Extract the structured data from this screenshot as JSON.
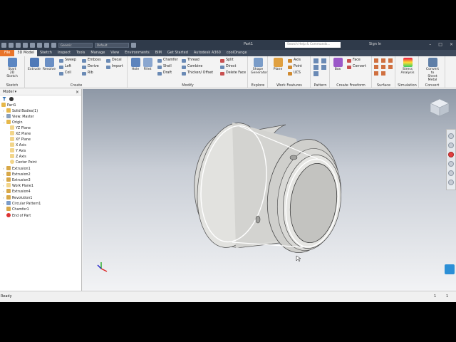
{
  "window": {
    "doc_title": "Part1",
    "search_placeholder": "Search Help & Commands...",
    "sign_in": "Sign In",
    "material": "Generic",
    "appearance": "Default"
  },
  "tabs": [
    "File",
    "3D Model",
    "Sketch",
    "Inspect",
    "Tools",
    "Manage",
    "View",
    "Environments",
    "BIM",
    "Get Started",
    "Autodesk A360",
    "coolOrange"
  ],
  "ribbon": {
    "sketch": {
      "start_line1": "Start",
      "start_line2": "2D Sketch",
      "group": "Sketch"
    },
    "create": {
      "extrude": "Extrude",
      "revolve": "Revolve",
      "sweep": "Sweep",
      "loft": "Loft",
      "coil": "Coil",
      "emboss": "Emboss",
      "derive": "Derive",
      "rib": "Rib",
      "decal": "Decal",
      "import": "Import",
      "group": "Create"
    },
    "modify": {
      "hole": "Hole",
      "fillet": "Fillet",
      "chamfer": "Chamfer",
      "shell": "Shell",
      "draft": "Draft",
      "thread": "Thread",
      "combine": "Combine",
      "thicken": "Thicken/ Offset",
      "split": "Split",
      "direct": "Direct",
      "delete_face": "Delete Face",
      "group": "Modify"
    },
    "explore": {
      "shape_line1": "Shape",
      "shape_line2": "Generator",
      "group": "Explore"
    },
    "work": {
      "plane": "Plane",
      "axis": "Axis",
      "point": "Point",
      "ucs": "UCS",
      "group": "Work Features"
    },
    "pattern": {
      "group": "Pattern"
    },
    "freeform": {
      "box": "Box",
      "face": "Face",
      "convert": "Convert",
      "group": "Create Freeform"
    },
    "surface": {
      "group": "Surface"
    },
    "simulation": {
      "stress_line1": "Stress",
      "stress_line2": "Analysis",
      "group": "Simulation"
    },
    "convert": {
      "sheet_line1": "Convert to",
      "sheet_line2": "Sheet Metal",
      "group": "Convert"
    }
  },
  "browser": {
    "title": "Model",
    "nodes": [
      "Part1",
      "Solid Bodies(1)",
      "View: Master",
      "Origin",
      "YZ Plane",
      "XZ Plane",
      "XY Plane",
      "X Axis",
      "Y Axis",
      "Z Axis",
      "Center Point",
      "Extrusion1",
      "Extrusion2",
      "Extrusion3",
      "Work Plane1",
      "Extrusion4",
      "Revolution1",
      "Circular Pattern1",
      "Chamfer1",
      "End of Part"
    ]
  },
  "status": {
    "ready": "Ready",
    "count1": "1",
    "count2": "1"
  },
  "colors": {
    "file_tab": "#e8742a",
    "titlebar": "#2f3a4a",
    "accent": "#2b8fd6"
  }
}
